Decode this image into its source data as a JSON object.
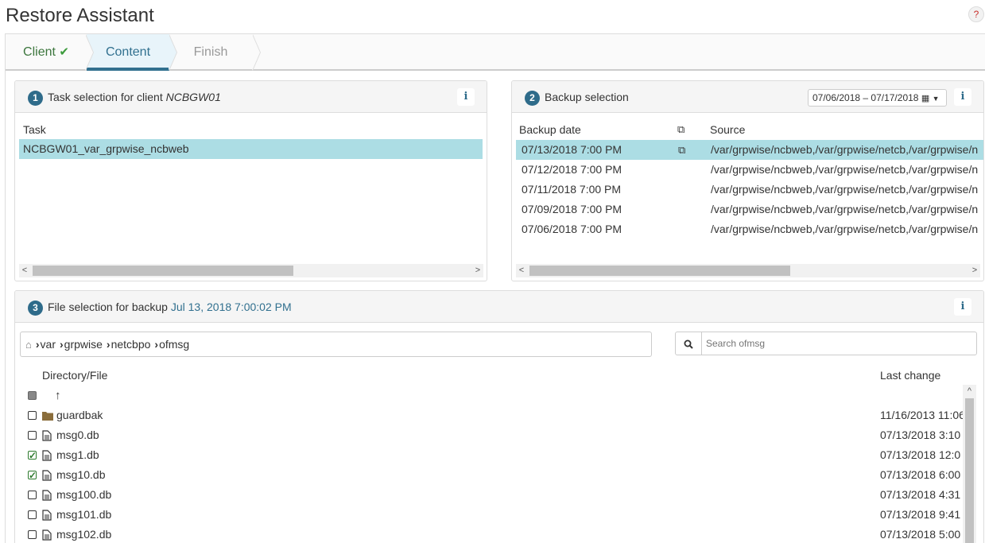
{
  "header": {
    "title": "Restore Assistant",
    "help_label": "?"
  },
  "wizard": {
    "steps": [
      {
        "label": "Client",
        "state": "done"
      },
      {
        "label": "Content",
        "state": "active"
      },
      {
        "label": "Finish",
        "state": "pending"
      }
    ]
  },
  "task_panel": {
    "badge": "1",
    "title_prefix": "Task selection for client ",
    "client": "NCBGW01",
    "info": "i",
    "column": "Task",
    "tasks": [
      "NCBGW01_var_grpwise_ncbweb"
    ]
  },
  "backup_panel": {
    "badge": "2",
    "title": "Backup selection",
    "date_range": "07/06/2018 – 07/17/2018",
    "info": "i",
    "columns": {
      "date": "Backup date",
      "source": "Source"
    },
    "backups": [
      {
        "date": "07/13/2018 7:00 PM",
        "source": "/var/grpwise/ncbweb,/var/grpwise/netcb,/var/grpwise/n",
        "selected": true
      },
      {
        "date": "07/12/2018 7:00 PM",
        "source": "/var/grpwise/ncbweb,/var/grpwise/netcb,/var/grpwise/n"
      },
      {
        "date": "07/11/2018 7:00 PM",
        "source": "/var/grpwise/ncbweb,/var/grpwise/netcb,/var/grpwise/n"
      },
      {
        "date": "07/09/2018 7:00 PM",
        "source": "/var/grpwise/ncbweb,/var/grpwise/netcb,/var/grpwise/n"
      },
      {
        "date": "07/06/2018 7:00 PM",
        "source": "/var/grpwise/ncbweb,/var/grpwise/netcb,/var/grpwise/n"
      }
    ]
  },
  "file_panel": {
    "badge": "3",
    "title_prefix": "File selection for backup ",
    "backup_time": "Jul 13, 2018 7:00:02 PM",
    "info": "i",
    "breadcrumb": [
      "var",
      "grpwise",
      "netcbpo",
      "ofmsg"
    ],
    "search_placeholder": "Search ofmsg",
    "columns": {
      "name": "Directory/File",
      "changed": "Last change"
    },
    "files": [
      {
        "name": "guardbak",
        "type": "folder",
        "checked": false,
        "changed": "11/16/2013 11:06"
      },
      {
        "name": "msg0.db",
        "type": "file",
        "checked": false,
        "changed": "07/13/2018 3:10"
      },
      {
        "name": "msg1.db",
        "type": "file",
        "checked": true,
        "changed": "07/13/2018 12:0"
      },
      {
        "name": "msg10.db",
        "type": "file",
        "checked": true,
        "changed": "07/13/2018 6:00"
      },
      {
        "name": "msg100.db",
        "type": "file",
        "checked": false,
        "changed": "07/13/2018 4:31"
      },
      {
        "name": "msg101.db",
        "type": "file",
        "checked": false,
        "changed": "07/13/2018 9:41"
      },
      {
        "name": "msg102.db",
        "type": "file",
        "checked": false,
        "changed": "07/13/2018 5:00"
      }
    ]
  }
}
